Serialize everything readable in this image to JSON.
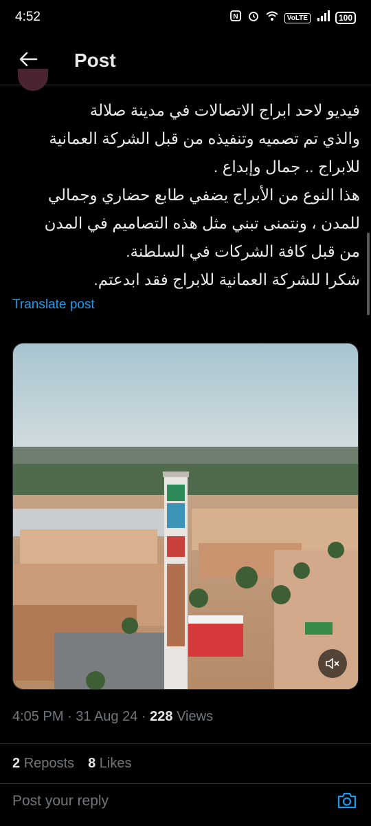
{
  "status_bar": {
    "time": "4:52",
    "volte": "VoLTE",
    "battery": "100",
    "icons": [
      "nfc-icon",
      "alarm-icon",
      "wifi-icon",
      "signal-icon",
      "battery-icon"
    ]
  },
  "header": {
    "title": "Post"
  },
  "post": {
    "lines": [
      "فيديو لاحد ابراج الاتصالات في مدينة صلالة",
      "والذي تم تصميه وتنفيذه من قبل الشركة العمانية",
      "للابراج .. جمال وإبداع .",
      "هذا النوع من الأبراج يضفي طابع حضاري وجمالي",
      "للمدن ، ونتمنى تبني مثل هذه التصاميم  في المدن",
      "من قبل كافة الشركات في السلطنة.",
      "شكرا للشركة العمانية للابراج فقد ابدعتم."
    ],
    "translate_label": "Translate post",
    "time": "4:05 PM",
    "date": "31 Aug 24",
    "views_count": "228",
    "views_label": "Views",
    "reposts_count": "2",
    "reposts_label": "Reposts",
    "likes_count": "8",
    "likes_label": "Likes"
  },
  "reply": {
    "placeholder": "Post your reply"
  },
  "colors": {
    "background": "#000000",
    "text": "#e7e9ea",
    "muted": "#71767b",
    "accent": "#1d9bf0",
    "divider": "#2f3336"
  }
}
